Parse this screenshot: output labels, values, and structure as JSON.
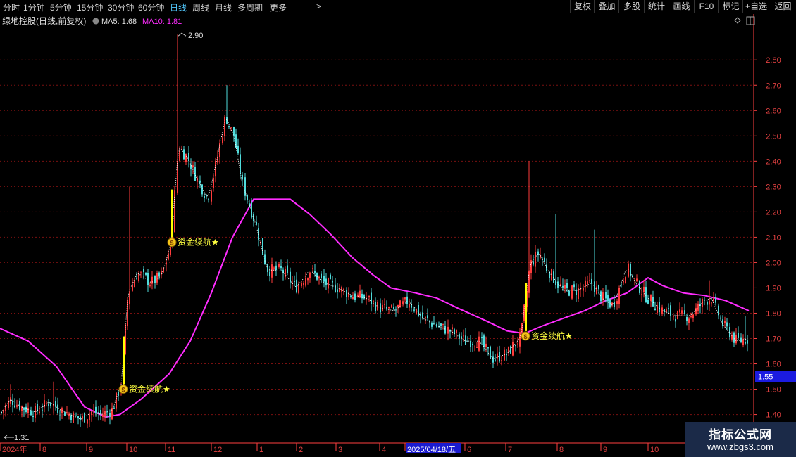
{
  "topbar": {
    "tabs": [
      {
        "label": "分时",
        "active": false
      },
      {
        "label": "1分钟",
        "active": false
      },
      {
        "label": "5分钟",
        "active": false
      },
      {
        "label": "15分钟",
        "active": false
      },
      {
        "label": "30分钟",
        "active": false
      },
      {
        "label": "60分钟",
        "active": false
      },
      {
        "label": "日线",
        "active": true
      },
      {
        "label": "周线",
        "active": false
      },
      {
        "label": "月线",
        "active": false
      },
      {
        "label": "多周期",
        "active": false
      },
      {
        "label": "更多",
        "active": false
      }
    ],
    "more_arrow": ">",
    "right_buttons": [
      "复权",
      "叠加",
      "多股",
      "统计",
      "画线",
      "F10",
      "标记",
      "+自选",
      "返回"
    ]
  },
  "header": {
    "stock": "绿地控股(日线,前复权)",
    "ma5_label": "MA5: 1.68",
    "ma10_label": "MA10: 1.81"
  },
  "colors": {
    "up": "#ff3c3c",
    "down": "#50dcdc",
    "ma_line": "#ff2cff",
    "signal": "#ffff00",
    "axis": "#ff4040",
    "price_box": "#1b1be0"
  },
  "chart_data": {
    "type": "candlestick",
    "y_ticks": [
      1.4,
      1.5,
      1.6,
      1.7,
      1.8,
      1.9,
      2.0,
      2.1,
      2.2,
      2.3,
      2.4,
      2.5,
      2.6,
      2.7,
      2.8
    ],
    "ylim": [
      1.31,
      2.92
    ],
    "x_labels": [
      "2024年",
      "8",
      "9",
      "10",
      "11",
      "12",
      "1",
      "2",
      "3",
      "4",
      "2025/04/18/五",
      "6",
      "7",
      "8",
      "9",
      "10"
    ],
    "high_marker": "2.90",
    "low_marker": "1.31",
    "current_price": "1.55",
    "signal_label": "资金续航★",
    "signal_icon": "money-bag-icon",
    "signals": [
      {
        "x": 175,
        "price": 1.5
      },
      {
        "x": 244,
        "price": 2.08
      },
      {
        "x": 746,
        "price": 1.71
      }
    ],
    "ma_curve": [
      [
        0,
        1.74
      ],
      [
        40,
        1.69
      ],
      [
        80,
        1.59
      ],
      [
        120,
        1.43
      ],
      [
        150,
        1.39
      ],
      [
        170,
        1.4
      ],
      [
        200,
        1.46
      ],
      [
        240,
        1.56
      ],
      [
        270,
        1.69
      ],
      [
        300,
        1.88
      ],
      [
        330,
        2.1
      ],
      [
        360,
        2.25
      ],
      [
        385,
        2.25
      ],
      [
        412,
        2.25
      ],
      [
        440,
        2.19
      ],
      [
        470,
        2.11
      ],
      [
        500,
        2.02
      ],
      [
        530,
        1.95
      ],
      [
        555,
        1.9
      ],
      [
        590,
        1.88
      ],
      [
        620,
        1.86
      ],
      [
        650,
        1.82
      ],
      [
        690,
        1.77
      ],
      [
        720,
        1.73
      ],
      [
        745,
        1.72
      ],
      [
        770,
        1.75
      ],
      [
        800,
        1.78
      ],
      [
        830,
        1.81
      ],
      [
        860,
        1.85
      ],
      [
        890,
        1.88
      ],
      [
        920,
        1.94
      ],
      [
        940,
        1.91
      ],
      [
        970,
        1.88
      ],
      [
        1000,
        1.87
      ],
      [
        1030,
        1.85
      ],
      [
        1063,
        1.81
      ]
    ],
    "price_path": [
      [
        0,
        1.4
      ],
      [
        15,
        1.46
      ],
      [
        30,
        1.43
      ],
      [
        50,
        1.41
      ],
      [
        70,
        1.45
      ],
      [
        85,
        1.42
      ],
      [
        100,
        1.4
      ],
      [
        115,
        1.38
      ],
      [
        130,
        1.41
      ],
      [
        145,
        1.4
      ],
      [
        160,
        1.42
      ],
      [
        172,
        1.52
      ],
      [
        182,
        1.88
      ],
      [
        195,
        1.96
      ],
      [
        215,
        1.92
      ],
      [
        230,
        1.95
      ],
      [
        244,
        2.09
      ],
      [
        253,
        2.46
      ],
      [
        265,
        2.42
      ],
      [
        280,
        2.33
      ],
      [
        295,
        2.25
      ],
      [
        310,
        2.43
      ],
      [
        320,
        2.58
      ],
      [
        332,
        2.5
      ],
      [
        345,
        2.3
      ],
      [
        360,
        2.18
      ],
      [
        380,
        1.97
      ],
      [
        400,
        1.97
      ],
      [
        420,
        1.9
      ],
      [
        440,
        1.97
      ],
      [
        460,
        1.92
      ],
      [
        480,
        1.9
      ],
      [
        500,
        1.87
      ],
      [
        520,
        1.86
      ],
      [
        540,
        1.82
      ],
      [
        560,
        1.81
      ],
      [
        580,
        1.85
      ],
      [
        600,
        1.78
      ],
      [
        620,
        1.75
      ],
      [
        640,
        1.73
      ],
      [
        660,
        1.69
      ],
      [
        680,
        1.69
      ],
      [
        700,
        1.62
      ],
      [
        720,
        1.64
      ],
      [
        740,
        1.71
      ],
      [
        752,
        1.99
      ],
      [
        765,
        2.04
      ],
      [
        780,
        1.96
      ],
      [
        800,
        1.89
      ],
      [
        820,
        1.89
      ],
      [
        840,
        1.92
      ],
      [
        855,
        1.86
      ],
      [
        870,
        1.83
      ],
      [
        890,
        1.98
      ],
      [
        905,
        1.91
      ],
      [
        920,
        1.86
      ],
      [
        940,
        1.81
      ],
      [
        960,
        1.79
      ],
      [
        980,
        1.79
      ],
      [
        1000,
        1.85
      ],
      [
        1010,
        1.86
      ],
      [
        1025,
        1.76
      ],
      [
        1045,
        1.69
      ],
      [
        1063,
        1.7
      ]
    ]
  },
  "watermark": {
    "line1": "指标公式网",
    "line2": "www.zbgs3.com"
  }
}
